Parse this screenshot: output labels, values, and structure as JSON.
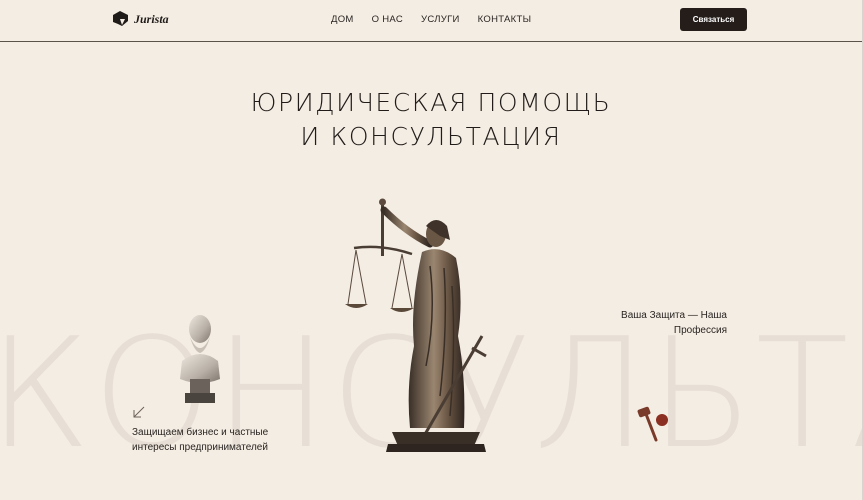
{
  "header": {
    "logo_text": "Jurista",
    "nav": [
      "ДОМ",
      "О НАС",
      "УСЛУГИ",
      "КОНТАКТЫ"
    ],
    "cta_label": "Связаться"
  },
  "hero": {
    "title_line1": "ЮРИДИЧЕСКАЯ ПОМОЩЬ",
    "title_line2": "И КОНСУЛЬТАЦИЯ",
    "background_word": "КОНСУЛЬТА",
    "left_text_line1": "Защищаем бизнес и частные",
    "left_text_line2": "интересы предпринимателей",
    "right_text_line1": "Ваша Защита — Наша",
    "right_text_line2": "Профессия"
  },
  "colors": {
    "background": "#f4ede4",
    "text": "#1f1b18",
    "button": "#241d1a",
    "watermark": "#e7dfd5",
    "bronze": "#7a6652"
  },
  "icons": [
    "logo-icon",
    "arrow-down-left-icon",
    "gavel-icon"
  ]
}
